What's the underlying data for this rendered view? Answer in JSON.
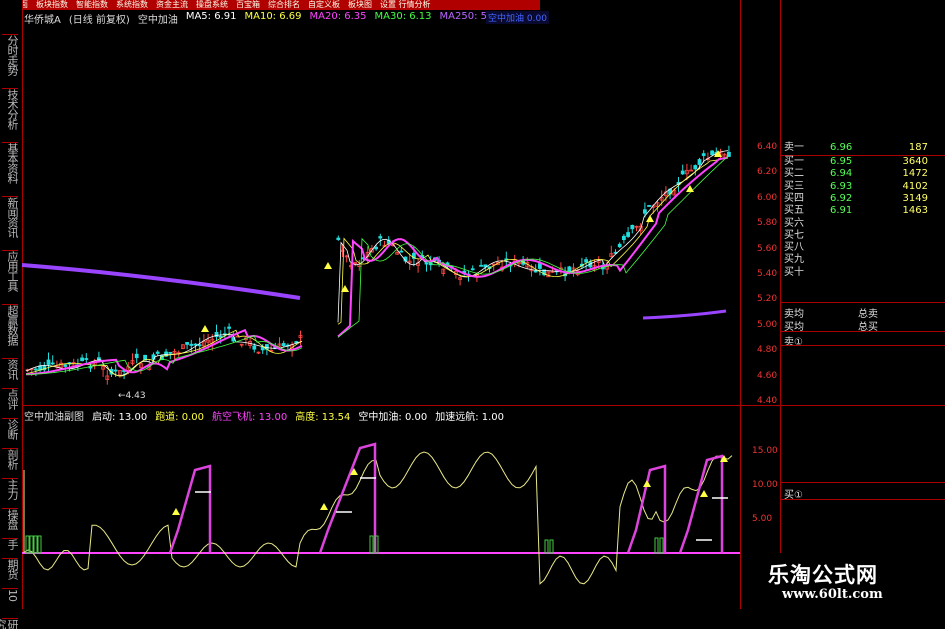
{
  "menubar": {
    "items": [
      "分析面",
      "板块指数",
      "智能指数",
      "系统指数",
      "资金主流",
      "操盘系统",
      "百宝箱",
      "综合排名",
      "自定义板",
      "板块图",
      "设置 行情分析"
    ]
  },
  "left_tabs": [
    "分时走势",
    "技术分析",
    "基本资料",
    "新闻资讯",
    "应用工具",
    "超赢数据",
    "资讯",
    "点评",
    "诊断",
    "剖析",
    "主力",
    "操盘",
    "手",
    "期货",
    "10",
    "研究"
  ],
  "main_header": {
    "stock": "华侨城A",
    "period": "(日线 前复权)",
    "indicator": "空中加油",
    "ma": [
      {
        "label": "MA5: 6.91",
        "color": "#ffffff"
      },
      {
        "label": "MA10: 6.69",
        "color": "#ffff44"
      },
      {
        "label": "MA20: 6.35",
        "color": "#ff44ff"
      },
      {
        "label": "MA30: 6.13",
        "color": "#44ff44"
      },
      {
        "label": "MA250: 5.09",
        "color": "#bb66ff"
      }
    ],
    "right_label": "空中加油",
    "right_label_color": "#2233ff",
    "right_value": "0.00"
  },
  "price_axis": [
    "6.40",
    "6.20",
    "6.00",
    "5.80",
    "5.60",
    "5.40",
    "5.20",
    "5.00",
    "4.80",
    "4.60",
    "4.40"
  ],
  "low_marker": "4.43",
  "sub_header": {
    "title": "空中加油副图",
    "items": [
      {
        "label": "启动: 13.00",
        "color": "#ffffff"
      },
      {
        "label": "跑道: 0.00",
        "color": "#ffff44"
      },
      {
        "label": "航空飞机: 13.00",
        "color": "#ff44ff"
      },
      {
        "label": "高度: 13.54",
        "color": "#ffff44"
      },
      {
        "label": "空中加油: 0.00",
        "color": "#ffffff"
      },
      {
        "label": "加速远航: 1.00",
        "color": "#ffffff"
      }
    ]
  },
  "sub_axis": [
    "15.00",
    "10.00",
    "5.00"
  ],
  "order_book": {
    "sell1": {
      "name": "卖一",
      "price": "6.96",
      "volume": "187"
    },
    "buys": [
      {
        "name": "买一",
        "price": "6.95",
        "volume": "3640"
      },
      {
        "name": "买二",
        "price": "6.94",
        "volume": "1472"
      },
      {
        "name": "买三",
        "price": "6.93",
        "volume": "4102"
      },
      {
        "name": "买四",
        "price": "6.92",
        "volume": "3149"
      },
      {
        "name": "买五",
        "price": "6.91",
        "volume": "1463"
      },
      {
        "name": "买六",
        "price": "",
        "volume": ""
      },
      {
        "name": "买七",
        "price": "",
        "volume": ""
      },
      {
        "name": "买八",
        "price": "",
        "volume": ""
      },
      {
        "name": "买九",
        "price": "",
        "volume": ""
      },
      {
        "name": "买十",
        "price": "",
        "volume": ""
      }
    ],
    "sell_avg": "卖均",
    "buy_avg": "买均",
    "total_sell": "总卖",
    "total_buy": "总买",
    "sell_queue": "卖①",
    "buy_queue": "买①"
  },
  "watermark": {
    "title": "乐淘公式网",
    "url": "www.60lt.com"
  }
}
